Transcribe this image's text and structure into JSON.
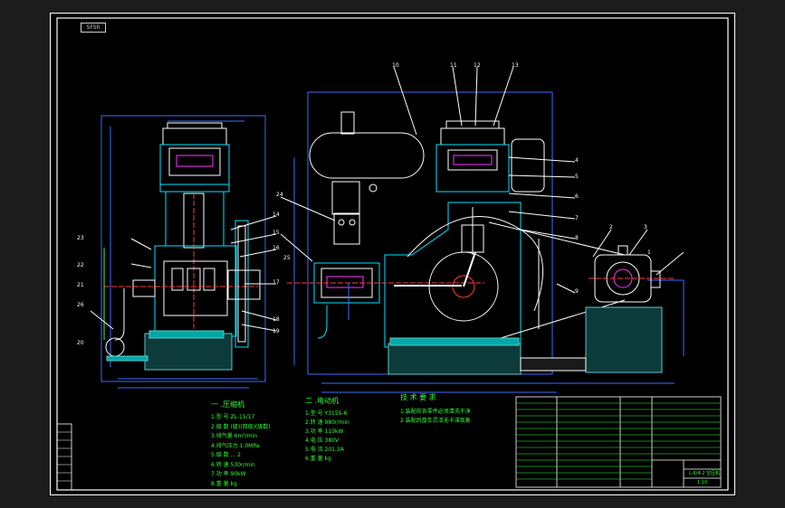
{
  "sheet": {
    "colors": {
      "frame": "#ffffff",
      "outline": "#ffffff",
      "dimension": "#3b6cff",
      "section": "#00e5ff",
      "annotation": "#33ff33",
      "leader": "#ff3b3b",
      "magenta": "#ff33ff",
      "foundation": "#5ac8c8",
      "background": "#000000"
    },
    "corner_tag": "SFSh"
  },
  "left_view": {
    "callouts": [
      "14",
      "15",
      "16",
      "17",
      "18",
      "19",
      "20",
      "21",
      "22",
      "23",
      "24",
      "25",
      "26"
    ]
  },
  "right_view": {
    "callouts_top": [
      "10",
      "11",
      "12",
      "13"
    ],
    "callouts_right": [
      "1",
      "2",
      "3",
      "4",
      "5",
      "6",
      "7",
      "8",
      "9"
    ]
  },
  "notes": {
    "section1_title": "一 .压缩机",
    "section1_rows": [
      "1.型  号    ZL-15/17",
      "2.级  数   (级)(双级)(级数)",
      "3.排气量     6m³/min",
      "4.排气压力    1.0MPa",
      "5.级 数 ... 2",
      "6.转  速     530r/min",
      "7.功  率      90kW",
      "8.重  量      kg"
    ],
    "section2_title": "二 .电动机",
    "section2_rows": [
      "1.型  号    Y315S-6",
      "2.转  速   980r/min",
      "3.功  率     110kW",
      "4.电  压     380V",
      "5.电  流     201.3A",
      "6.重  量      kg"
    ],
    "section3_title": "技 术 要 求",
    "section3_rows": [
      "1.装配前各零件必须清洗干净",
      "2.装配后盘车灵活无卡滞现象"
    ]
  },
  "title_block": {
    "drawing_name": "L-6/4-2 空压机",
    "scale": "1:10"
  }
}
